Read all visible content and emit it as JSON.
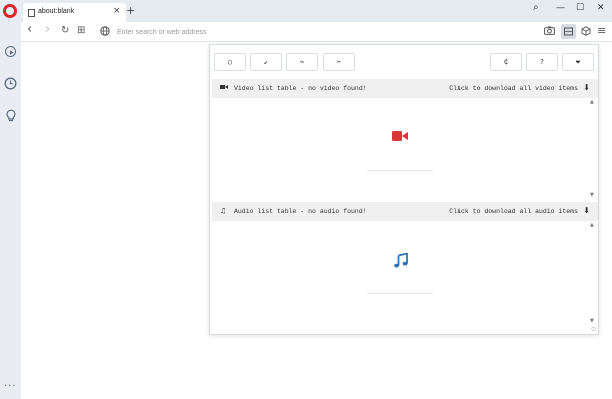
{
  "browser": {
    "tab": {
      "title": "about:blank",
      "close": "×"
    },
    "new_tab": "+",
    "window_controls": {
      "search": "⌕",
      "minimize": "—",
      "maximize": "☐",
      "close": "✕"
    },
    "address": {
      "placeholder": "Enter search or web address",
      "value": ""
    },
    "nav": {
      "back": "‹",
      "forward": "›",
      "reload": "↻",
      "speed_dial": "⊞",
      "globe": "🌐"
    },
    "toolbar_right": {
      "camera": "📷",
      "ext": "▤",
      "cube": "⬡",
      "menu": "≡"
    },
    "sidebar": {
      "more": "···"
    }
  },
  "popup": {
    "tools_left": [
      "○",
      "↙",
      "⌁",
      "✂"
    ],
    "tools_right": [
      "₵",
      "?",
      "❤"
    ],
    "video": {
      "header": "Video list table - no video found!",
      "download": "Click to download all video items",
      "arrow": "›",
      "download_icon": "⬇",
      "icon": "video-camera-icon",
      "color": "#d93838"
    },
    "audio": {
      "header": "Audio list table - no audio found!",
      "download": "Click to download all audio items",
      "arrow": "›",
      "download_icon": "⬇",
      "icon": "music-note-icon",
      "color": "#2e74b5"
    },
    "scroll_up": "▲",
    "scroll_down": "▼",
    "resize_grip": "⊙"
  },
  "colors": {
    "opera_red": "#d62a2a",
    "sidebar_bg": "#e9edf3"
  }
}
